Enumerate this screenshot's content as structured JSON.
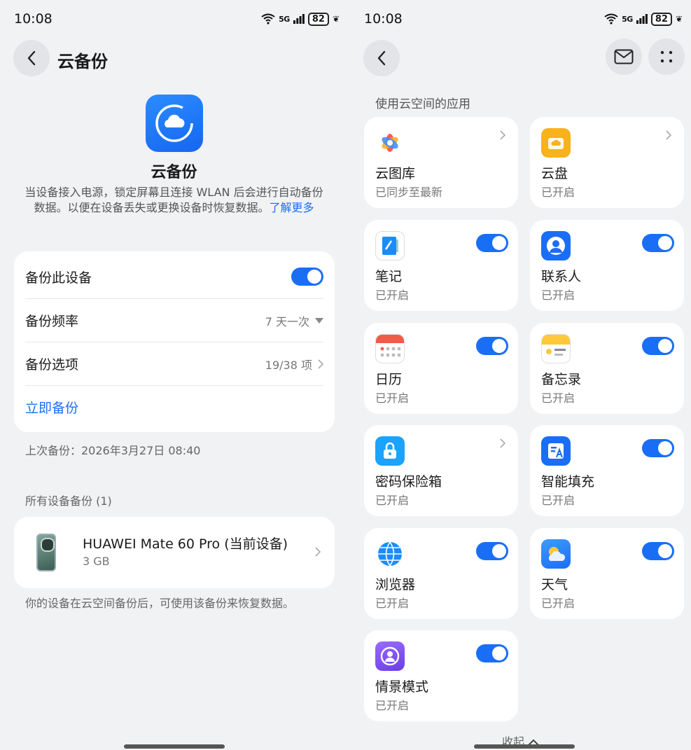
{
  "status_bar": {
    "time": "10:08",
    "network": "5G",
    "battery": "82"
  },
  "left": {
    "title": "云备份",
    "app_name": "云备份",
    "description": "当设备接入电源，锁定屏幕且连接 WLAN 后会进行自动备份数据。以便在设备丢失或更换设备时恢复数据。",
    "learn_more": "了解更多",
    "settings": {
      "backup_device": {
        "label": "备份此设备",
        "enabled": true
      },
      "frequency": {
        "label": "备份频率",
        "value": "7 天一次"
      },
      "options": {
        "label": "备份选项",
        "value": "19/38 项"
      },
      "backup_now": "立即备份"
    },
    "last_backup": "上次备份：2026年3月27日 08:40",
    "all_devices_title": "所有设备备份 (1)",
    "device": {
      "name": "HUAWEI Mate 60 Pro (当前设备)",
      "size": "3 GB"
    },
    "footer_note": "你的设备在云空间备份后，可使用该备份来恢复数据。"
  },
  "right": {
    "section_title": "使用云空间的应用",
    "apps": [
      {
        "name": "云图库",
        "status": "已同步至最新",
        "control": "chevron",
        "icon": "gallery-icon"
      },
      {
        "name": "云盘",
        "status": "已开启",
        "control": "chevron",
        "icon": "cloud-drive-icon"
      },
      {
        "name": "笔记",
        "status": "已开启",
        "control": "toggle",
        "icon": "notes-icon"
      },
      {
        "name": "联系人",
        "status": "已开启",
        "control": "toggle",
        "icon": "contacts-icon"
      },
      {
        "name": "日历",
        "status": "已开启",
        "control": "toggle",
        "icon": "calendar-icon"
      },
      {
        "name": "备忘录",
        "status": "已开启",
        "control": "toggle",
        "icon": "memo-icon"
      },
      {
        "name": "密码保险箱",
        "status": "已开启",
        "control": "chevron",
        "icon": "password-vault-icon"
      },
      {
        "name": "智能填充",
        "status": "已开启",
        "control": "toggle",
        "icon": "autofill-icon"
      },
      {
        "name": "浏览器",
        "status": "已开启",
        "control": "toggle",
        "icon": "browser-icon"
      },
      {
        "name": "天气",
        "status": "已开启",
        "control": "toggle",
        "icon": "weather-icon"
      },
      {
        "name": "情景模式",
        "status": "已开启",
        "control": "toggle",
        "icon": "scene-mode-icon"
      }
    ],
    "collapse_label": "收起"
  },
  "colors": {
    "accent": "#1a6ef5",
    "background": "#f1f2f4",
    "card": "#ffffff"
  }
}
